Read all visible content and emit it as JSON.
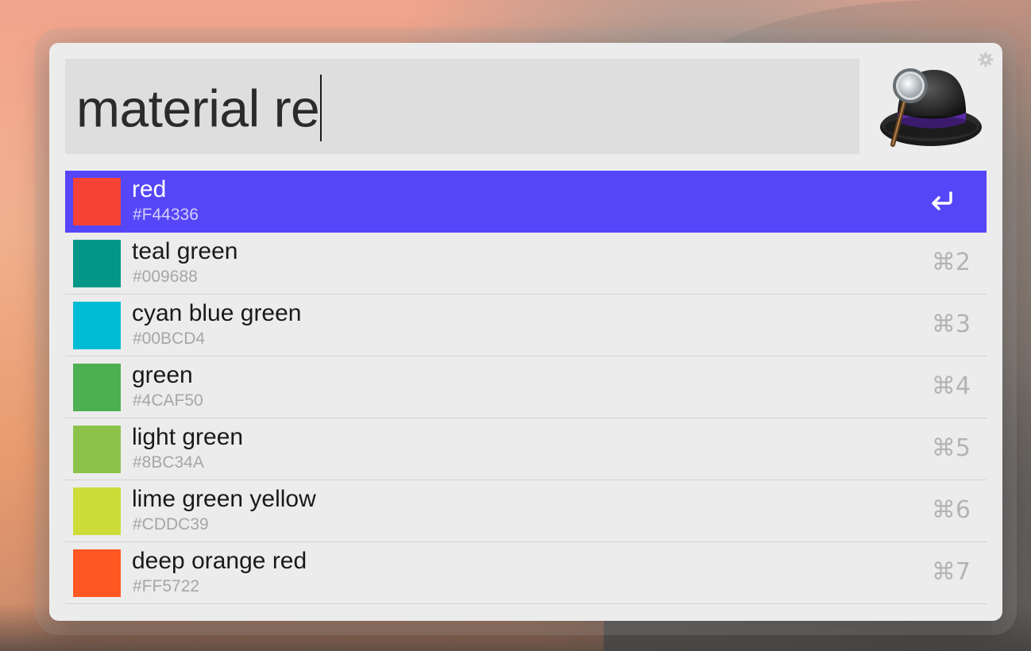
{
  "search": {
    "query": "material re"
  },
  "results": [
    {
      "title": "red",
      "subtitle": "#F44336",
      "color": "#F44336",
      "shortcut": "",
      "selected": true
    },
    {
      "title": "teal green",
      "subtitle": "#009688",
      "color": "#009688",
      "shortcut": "⌘2",
      "selected": false
    },
    {
      "title": "cyan blue green",
      "subtitle": "#00BCD4",
      "color": "#00BCD4",
      "shortcut": "⌘3",
      "selected": false
    },
    {
      "title": "green",
      "subtitle": "#4CAF50",
      "color": "#4CAF50",
      "shortcut": "⌘4",
      "selected": false
    },
    {
      "title": "light green",
      "subtitle": "#8BC34A",
      "color": "#8BC34A",
      "shortcut": "⌘5",
      "selected": false
    },
    {
      "title": "lime green yellow",
      "subtitle": "#CDDC39",
      "color": "#CDDC39",
      "shortcut": "⌘6",
      "selected": false
    },
    {
      "title": "deep orange red",
      "subtitle": "#FF5722",
      "color": "#FF5722",
      "shortcut": "⌘7",
      "selected": false
    }
  ],
  "icons": {
    "settings": "gear-icon",
    "app": "alfred-hat-icon",
    "return": "return-icon"
  },
  "colors": {
    "selection": "#5546F8",
    "window_background": "#ECECEC",
    "search_background": "#DEDEDE"
  }
}
